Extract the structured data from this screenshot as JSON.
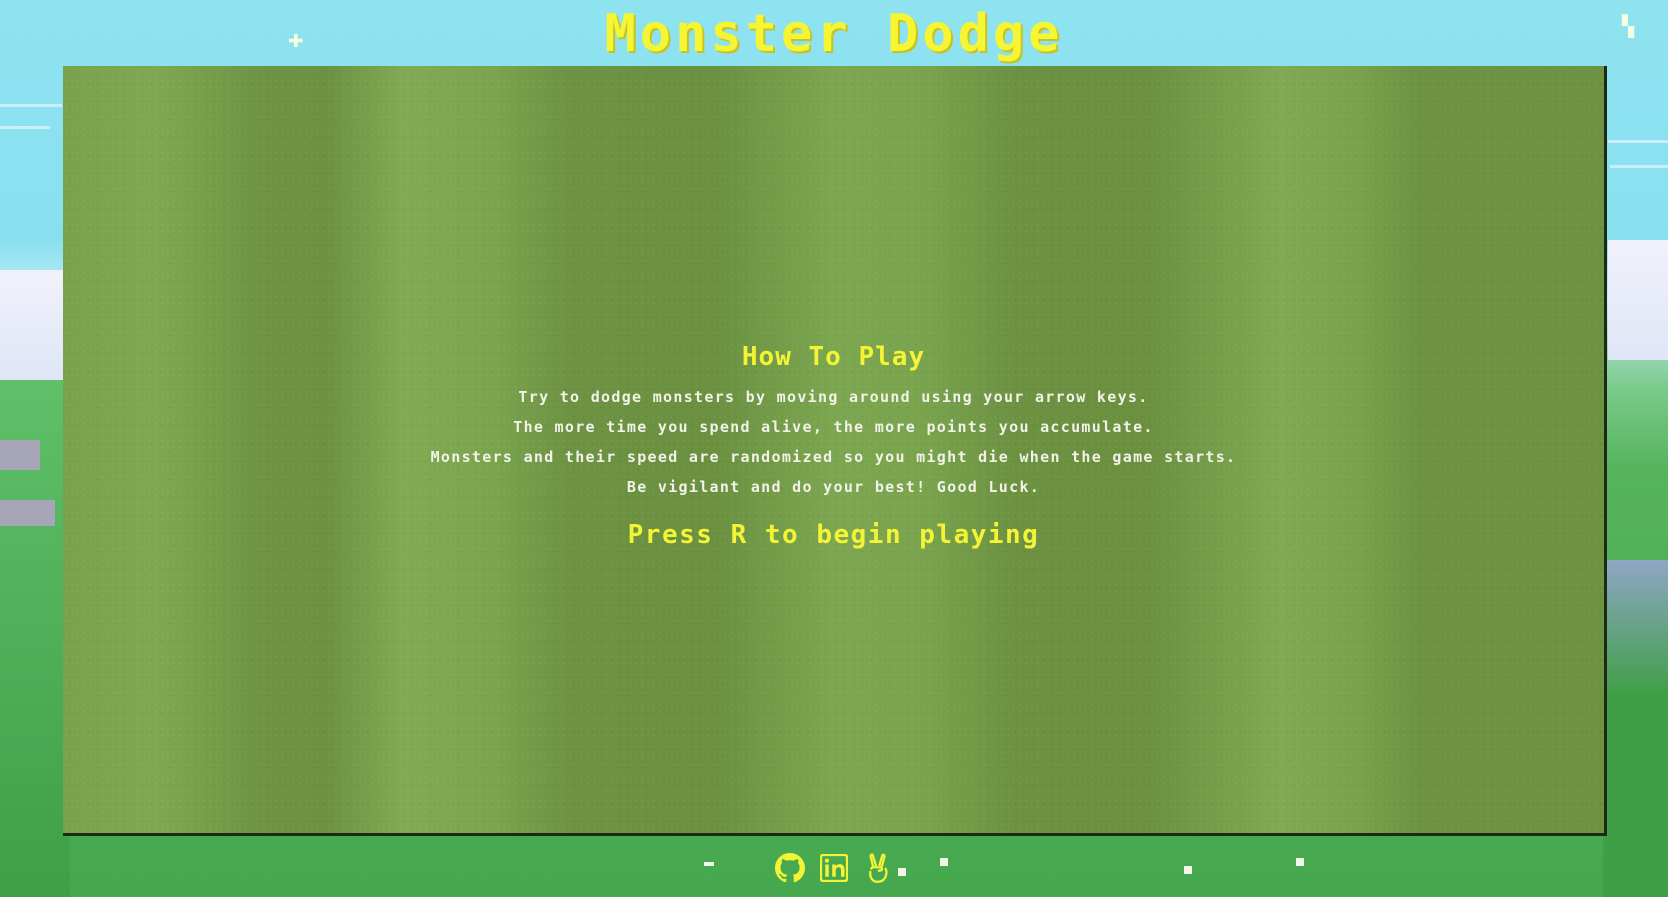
{
  "game": {
    "title": "Monster Dodge"
  },
  "instructions": {
    "heading": "How To Play",
    "lines": [
      "Try to dodge monsters by moving around using your arrow keys.",
      "The more time you spend alive, the more points you accumulate.",
      "Monsters and their speed are randomized so you might die when the game starts.",
      "Be vigilant and do your best! Good Luck."
    ],
    "start_prompt": "Press R to begin playing"
  },
  "footer": {
    "links": [
      {
        "icon": "github-icon"
      },
      {
        "icon": "linkedin-icon"
      },
      {
        "icon": "angellist-icon"
      }
    ]
  },
  "colors": {
    "accent_yellow": "#f4f437",
    "text_light": "#f2f2e8",
    "board_green": "#6c9242",
    "sky": "#88e0ef"
  }
}
